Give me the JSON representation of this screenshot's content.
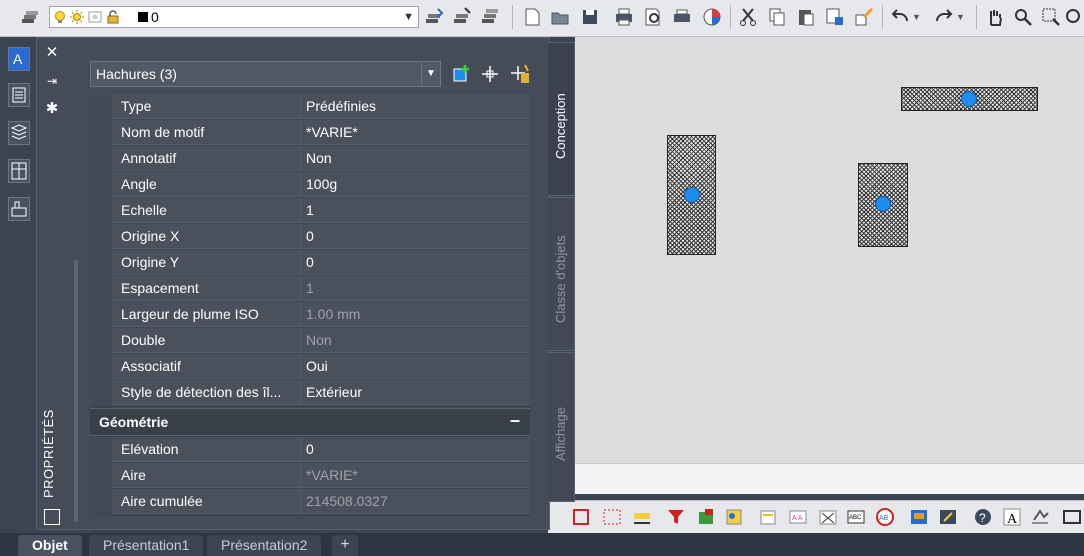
{
  "toolbar": {
    "layer_name": "0",
    "icons": [
      "layer-properties-icon",
      "layer-on-icon",
      "layer-freeze-icon",
      "layer-viewport-icon",
      "layer-lock-icon",
      "layer-color-swatch",
      "make-current-icon",
      "layer-match-icon",
      "layer-previous-icon",
      "new-icon",
      "open-icon",
      "save-icon",
      "plot-icon",
      "plot-preview-icon",
      "publish-icon",
      "3d-dwf-icon",
      "cut-icon",
      "copy-icon",
      "paste-icon",
      "match-properties-icon",
      "block-editor-icon",
      "undo-icon",
      "redo-icon",
      "pan-icon",
      "zoom-realtime-icon",
      "zoom-window-icon",
      "zoom-previous-icon"
    ]
  },
  "palette": {
    "title": "PROPRIÉTÉS",
    "selection": "Hachures (3)",
    "tools": {
      "toggle_pickadd": "toggle-pickadd-icon",
      "select_objects": "select-objects-icon",
      "quick_select": "quick-select-icon"
    },
    "tabs": [
      "Conception",
      "Classe d'objets",
      "Affichage"
    ],
    "properties": [
      {
        "name": "Type",
        "value": "Prédéfinies",
        "readonly": false
      },
      {
        "name": "Nom de motif",
        "value": "*VARIE*",
        "readonly": false
      },
      {
        "name": "Annotatif",
        "value": "Non",
        "readonly": false
      },
      {
        "name": "Angle",
        "value": "100g",
        "readonly": false
      },
      {
        "name": "Echelle",
        "value": "1",
        "readonly": false
      },
      {
        "name": "Origine X",
        "value": "0",
        "readonly": false
      },
      {
        "name": "Origine Y",
        "value": "0",
        "readonly": false
      },
      {
        "name": "Espacement",
        "value": "1",
        "readonly": true
      },
      {
        "name": "Largeur de plume ISO",
        "value": "1.00 mm",
        "readonly": true
      },
      {
        "name": "Double",
        "value": "Non",
        "readonly": true
      },
      {
        "name": "Associatif",
        "value": "Oui",
        "readonly": false
      },
      {
        "name": "Style de détection des îl...",
        "value": "Extérieur",
        "readonly": false
      }
    ],
    "geometry_category": {
      "label": "Géométrie",
      "toggle": "–",
      "properties": [
        {
          "name": "Elévation",
          "value": "0",
          "readonly": false
        },
        {
          "name": "Aire",
          "value": "*VARIE*",
          "readonly": true
        },
        {
          "name": "Aire cumulée",
          "value": "214508.0327",
          "readonly": true
        }
      ]
    }
  },
  "layout_tabs": [
    "Objet",
    "Présentation1",
    "Présentation2"
  ],
  "add_tab": "+",
  "colors": {
    "grip": "#1e8cf0",
    "palette_bg": "#454b57",
    "canvas_bg": "#dcdcdc"
  }
}
